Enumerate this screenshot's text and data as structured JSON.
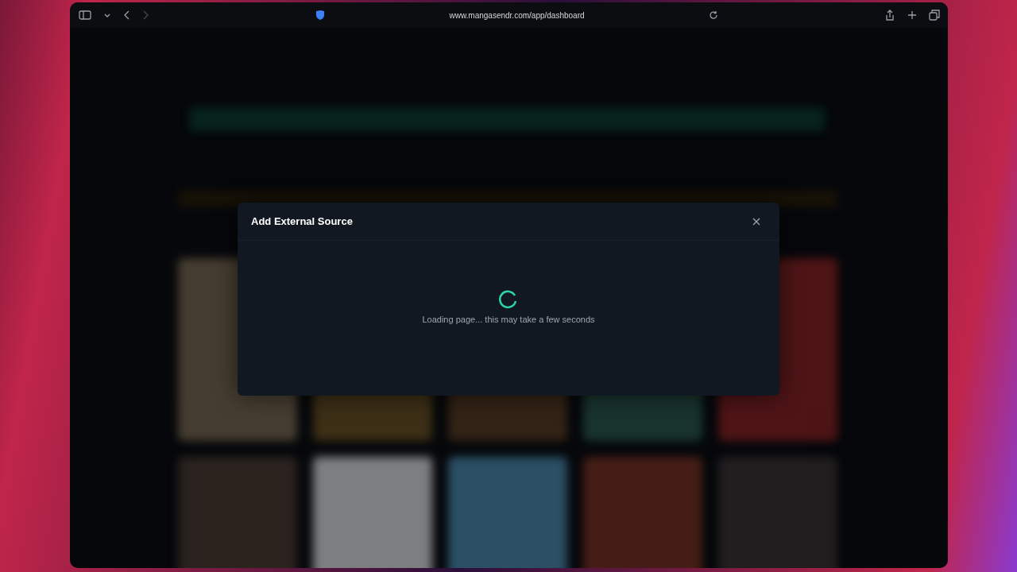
{
  "browser": {
    "url": "www.mangasendr.com/app/dashboard"
  },
  "modal": {
    "title": "Add External Source",
    "loading": true,
    "message": "Loading page... this may take a few seconds"
  }
}
